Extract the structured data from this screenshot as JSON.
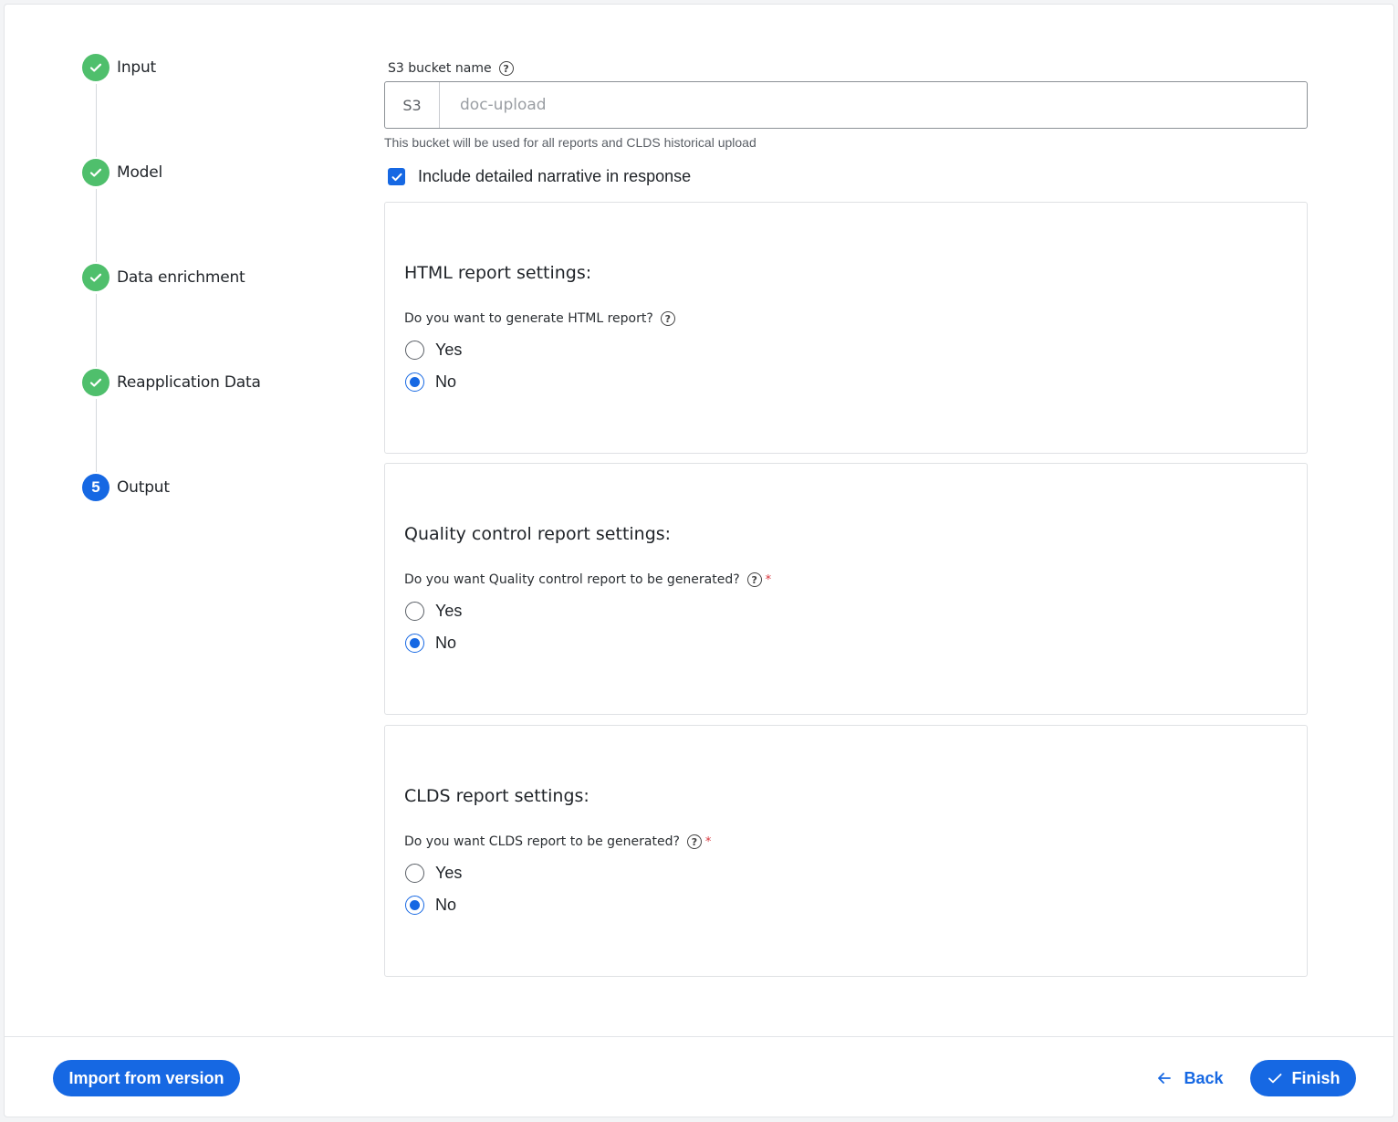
{
  "stepper": {
    "steps": [
      {
        "label": "Input",
        "state": "done"
      },
      {
        "label": "Model",
        "state": "done"
      },
      {
        "label": "Data enrichment",
        "state": "done"
      },
      {
        "label": "Reapplication Data",
        "state": "done"
      },
      {
        "label": "Output",
        "state": "current",
        "number": "5"
      }
    ]
  },
  "bucket": {
    "label": "S3 bucket name",
    "prefix": "S3",
    "placeholder": "doc-upload",
    "hint": "This bucket will be used for all reports and CLDS historical upload"
  },
  "narrative": {
    "label": "Include detailed narrative in response",
    "checked": true
  },
  "cards": [
    {
      "title": "HTML report settings:",
      "question": "Do you want to generate HTML report?",
      "required": false,
      "options": [
        "Yes",
        "No"
      ],
      "selected": "No"
    },
    {
      "title": "Quality control report settings:",
      "question": "Do you want Quality control report to be generated?",
      "required": true,
      "options": [
        "Yes",
        "No"
      ],
      "selected": "No"
    },
    {
      "title": "CLDS report settings:",
      "question": "Do you want CLDS report to be generated?",
      "required": true,
      "options": [
        "Yes",
        "No"
      ],
      "selected": "No"
    }
  ],
  "required_mark": "*",
  "help_glyph": "?",
  "footer": {
    "import_label": "Import from version",
    "back_label": "Back",
    "finish_label": "Finish"
  },
  "colors": {
    "primary": "#1668e3",
    "success": "#4fbf6c",
    "required": "#d9363e"
  }
}
